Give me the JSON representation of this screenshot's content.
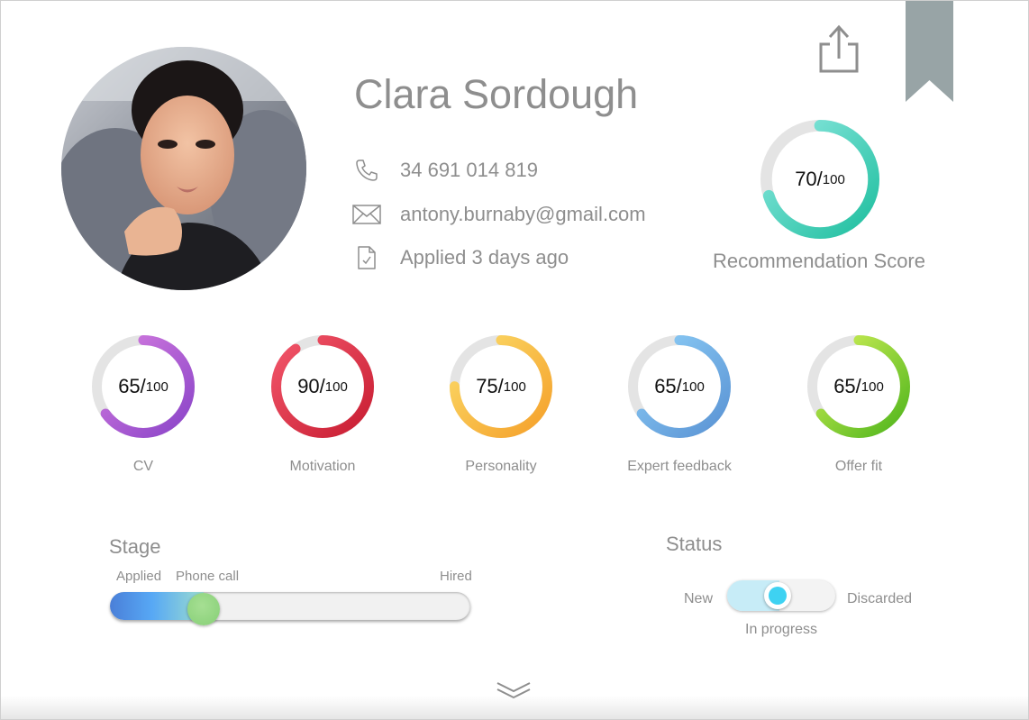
{
  "profile": {
    "name": "Clara Sordough",
    "phone": "34 691 014 819",
    "email": "antony.burnaby@gmail.com",
    "applied": "Applied 3 days ago"
  },
  "icons": {
    "phone": "phone-icon",
    "email": "envelope-icon",
    "applied": "document-check-icon",
    "share": "share-icon",
    "bookmark": "bookmark-icon",
    "expand": "chevron-down-icon"
  },
  "recommendation": {
    "score": 70,
    "score_text": "70/",
    "max_text": "100",
    "caption": "Recommendation Score",
    "colors": [
      "#1fbf9f",
      "#8de8e0"
    ]
  },
  "metrics": [
    {
      "id": "cv",
      "score": 65,
      "score_text": "65/",
      "max_text": "100",
      "label": "CV",
      "colors": [
        "#8a44c8",
        "#d77ee0"
      ]
    },
    {
      "id": "motivation",
      "score": 90,
      "score_text": "90/",
      "max_text": "100",
      "label": "Motivation",
      "colors": [
        "#c81d32",
        "#f2566a"
      ]
    },
    {
      "id": "personality",
      "score": 75,
      "score_text": "75/",
      "max_text": "100",
      "label": "Personality",
      "colors": [
        "#f5a02a",
        "#fbdc6a"
      ]
    },
    {
      "id": "expert-feedback",
      "score": 65,
      "score_text": "65/",
      "max_text": "100",
      "label": "Expert feedback",
      "colors": [
        "#5a93d4",
        "#8fd0f8"
      ]
    },
    {
      "id": "offer-fit",
      "score": 65,
      "score_text": "65/",
      "max_text": "100",
      "label": "Offer fit",
      "colors": [
        "#4fb51c",
        "#d6f25a"
      ]
    }
  ],
  "stage": {
    "title": "Stage",
    "labels": [
      "Applied",
      "Phone call",
      "Hired"
    ],
    "progress": 0.26
  },
  "status": {
    "title": "Status",
    "left_label": "New",
    "right_label": "Discarded",
    "current_label": "In progress",
    "accent": "#3ed2f2"
  },
  "colors": {
    "text_gray": "#8e8e8e",
    "bookmark": "#98a4a6",
    "ring_track": "#e4e4e4"
  }
}
